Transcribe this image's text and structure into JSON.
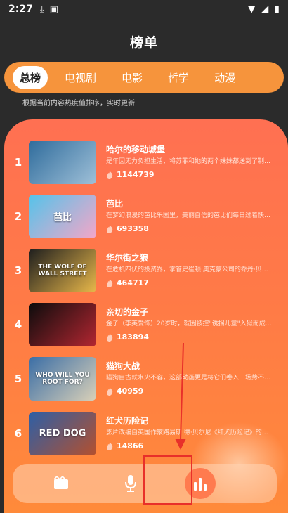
{
  "status": {
    "time": "2:27"
  },
  "page_title": "榜单",
  "tabs": [
    {
      "label": "总榜",
      "active": true
    },
    {
      "label": "电视剧"
    },
    {
      "label": "电影"
    },
    {
      "label": "哲学"
    },
    {
      "label": "动漫"
    }
  ],
  "hint": "根据当前内容热度值排序，实时更新",
  "items": [
    {
      "rank": "1",
      "title": "哈尔的移动城堡",
      "desc": "是年因无力负担生活，将苏菲和她的两个妹妹都送到了制…",
      "hot": "1144739",
      "poster_colors": [
        "#2f6c9c",
        "#9fc0d8"
      ],
      "poster_text": ""
    },
    {
      "rank": "2",
      "title": "芭比",
      "desc": "在梦幻浪漫的芭比乐园里，美丽自信的芭比们每日过着快…",
      "hot": "693358",
      "poster_colors": [
        "#55c3ea",
        "#f4a6c8"
      ],
      "poster_text": "芭比"
    },
    {
      "rank": "3",
      "title": "华尔街之狼",
      "desc": "在危机四伏的投资界，掌管史崔顿·奥克蒙公司的乔丹·贝…",
      "hot": "464717",
      "poster_colors": [
        "#1e1e1e",
        "#e9b84a"
      ],
      "poster_text": "THE WOLF OF WALL STREET"
    },
    {
      "rank": "4",
      "title": "亲切的金子",
      "desc": "金子（李英爱饰）20岁时，就因被控\"诱拐儿童\"入狱而成…",
      "hot": "183894",
      "poster_colors": [
        "#0c0c0c",
        "#b32631"
      ],
      "poster_text": ""
    },
    {
      "rank": "5",
      "title": "猫狗大战",
      "desc": "猫狗自古就水火不容，这部动画更是将它们卷入一场势不…",
      "hot": "40959",
      "poster_colors": [
        "#3b6ea6",
        "#d9d0b8"
      ],
      "poster_text": "WHO WILL YOU ROOT FOR?"
    },
    {
      "rank": "6",
      "title": "红犬历险记",
      "desc": "影片改编自英国作家路易斯·德·贝尔尼《红犬历险记》的…",
      "hot": "14866",
      "poster_colors": [
        "#2d5fa6",
        "#b4502e"
      ],
      "poster_text": "RED DOG"
    }
  ],
  "bottom_nav": [
    {
      "icon": "film-icon"
    },
    {
      "icon": "microphone-icon"
    },
    {
      "icon": "bar-chart-icon",
      "active": true
    }
  ],
  "colors": {
    "accent": "#ff7052",
    "tab_bar": "#f6943c",
    "annotation": "#e8302a"
  }
}
